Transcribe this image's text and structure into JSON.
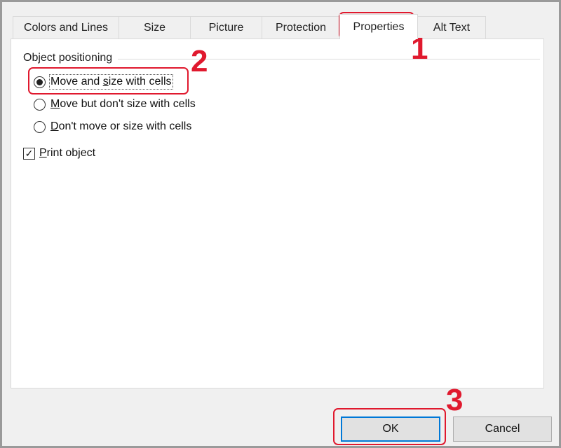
{
  "tabs": [
    {
      "label": "Colors and Lines",
      "active": false
    },
    {
      "label": "Size",
      "active": false
    },
    {
      "label": "Picture",
      "active": false
    },
    {
      "label": "Protection",
      "active": false
    },
    {
      "label": "Properties",
      "active": true
    },
    {
      "label": "Alt Text",
      "active": false
    }
  ],
  "object_positioning": {
    "group_label": "Object positioning",
    "options": [
      {
        "pre": "Move and ",
        "mnemonic": "s",
        "post": "ize with cells",
        "checked": true
      },
      {
        "pre": "",
        "mnemonic": "M",
        "post": "ove but don't size with cells",
        "checked": false
      },
      {
        "pre": "",
        "mnemonic": "D",
        "post": "on't move or size with cells",
        "checked": false
      }
    ]
  },
  "print_object": {
    "mnemonic": "P",
    "rest": "rint object",
    "checked": true,
    "check_glyph": "✓"
  },
  "buttons": {
    "ok": "OK",
    "cancel": "Cancel"
  },
  "annotations": {
    "step1": "1",
    "step2": "2",
    "step3": "3",
    "color": "#e0192e"
  }
}
